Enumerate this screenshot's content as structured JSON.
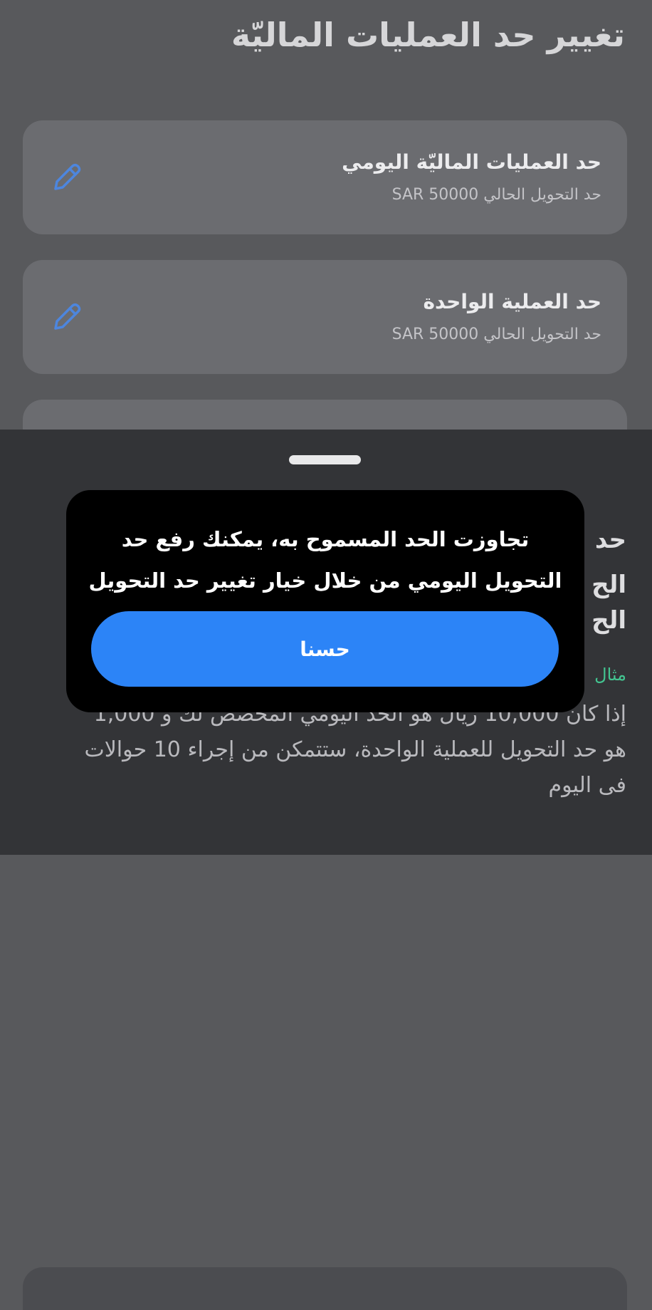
{
  "page": {
    "title": "تغيير حد العمليات الماليّة"
  },
  "limit_cards": [
    {
      "title": "حد العمليات الماليّة اليومي",
      "subtitle": "حد التحويل الحالي SAR 50000",
      "icon": "pencil-edit-icon"
    },
    {
      "title": "حد العملية الواحدة",
      "subtitle": "حد التحويل الحالي SAR 50000",
      "icon": "pencil-edit-icon"
    }
  ],
  "sheet": {
    "heading_lines": [
      "حد",
      "الح",
      "الح"
    ],
    "example_label": "مثال",
    "example_body": "إذا كان 10,000 ريال هو الحد اليومي المخصص لك و 1,000 هو حد التحويل للعملية الواحدة، ستتمكن من إجراء 10 حوالات فى اليوم"
  },
  "alert": {
    "message": "تجاوزت الحد المسموح به، يمكنك رفع حد التحويل اليومي من خلال خيار تغيير حد التحويل",
    "ok_label": "حسنا"
  },
  "colors": {
    "accent": "#2c84f7",
    "edit_icon": "#4d86de",
    "example_green": "#43c490"
  }
}
